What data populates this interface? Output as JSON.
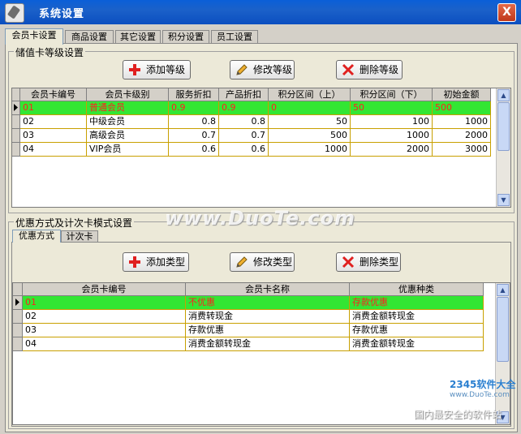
{
  "window": {
    "title": "系统设置",
    "close_label": "X"
  },
  "tabs": [
    "会员卡设置",
    "商品设置",
    "其它设置",
    "积分设置",
    "员工设置"
  ],
  "level_group": {
    "label": "储值卡等级设置",
    "add_label": "添加等级",
    "edit_label": "修改等级",
    "delete_label": "删除等级",
    "columns": [
      "会员卡编号",
      "会员卡级别",
      "服务折扣",
      "产品折扣",
      "积分区间（上）",
      "积分区间（下）",
      "初始金额"
    ],
    "rows": [
      [
        "01",
        "普通会员",
        "0.9",
        "0.9",
        "0",
        "50",
        "500"
      ],
      [
        "02",
        "中级会员",
        "0.8",
        "0.8",
        "50",
        "100",
        "1000"
      ],
      [
        "03",
        "高级会员",
        "0.7",
        "0.7",
        "500",
        "1000",
        "2000"
      ],
      [
        "04",
        "VIP会员",
        "0.6",
        "0.6",
        "1000",
        "2000",
        "3000"
      ]
    ]
  },
  "discount_group": {
    "label": "优惠方式及计次卡模式设置",
    "subtabs": [
      "优惠方式",
      "计次卡"
    ],
    "add_label": "添加类型",
    "edit_label": "修改类型",
    "delete_label": "删除类型",
    "columns": [
      "会员卡编号",
      "会员卡名称",
      "优惠种类"
    ],
    "rows": [
      [
        "01",
        "不优惠",
        "存款优惠"
      ],
      [
        "02",
        "消费转现金",
        "消费金额转现金"
      ],
      [
        "03",
        "存款优惠",
        "存款优惠"
      ],
      [
        "04",
        "消费金额转现金",
        "消费金额转现金"
      ]
    ]
  },
  "watermark": "www.DuoTe.com",
  "logo": {
    "brand": "2345软件大全",
    "domain": "www.DuoTe.com",
    "slogan": "国内最安全的软件站"
  },
  "colors": {
    "title_bar": "#1b61c9",
    "selected_row": "#33e633",
    "selected_text": "#ff2020",
    "grid_line": "#c8a000"
  }
}
